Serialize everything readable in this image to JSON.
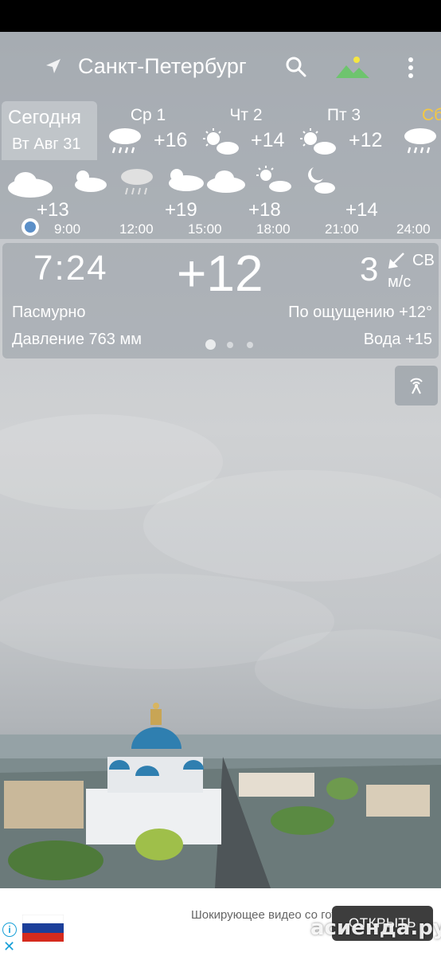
{
  "header": {
    "city": "Санкт-Петербург"
  },
  "today": {
    "label": "Сегодня",
    "date": "Вт Авг 31"
  },
  "days": [
    {
      "name": "Ср 1",
      "temp": "+16",
      "icon": "rain-cloud-icon"
    },
    {
      "name": "Чт 2",
      "temp": "+14",
      "icon": "sun-cloud-icon"
    },
    {
      "name": "Пт 3",
      "temp": "+12",
      "icon": "sun-cloud-icon"
    },
    {
      "name": "Сб",
      "temp": "",
      "icon": "rain-cloud-icon"
    }
  ],
  "hourly": {
    "temps": [
      "+13",
      "+19",
      "+18",
      "+14"
    ],
    "times": [
      "9:00",
      "12:00",
      "15:00",
      "18:00",
      "21:00",
      "24:00"
    ]
  },
  "current": {
    "time": "7:24",
    "temp": "+12",
    "wind_speed": "3",
    "wind_dir": "СВ",
    "wind_unit": "м/с",
    "condition": "Пасмурно",
    "feels_like": "По ощущению +12°",
    "pressure": "Давление 763 мм",
    "water": "Вода +15"
  },
  "ad": {
    "text": "Шокирующее видео со готовиться жить ...",
    "button": "ОТКРЫТЬ",
    "watermark": "асиенда.ру"
  },
  "colors": {
    "accent_day": "#f5c842",
    "now_dot": "#5b8fc8",
    "ad_button": "#3d3d3d"
  }
}
